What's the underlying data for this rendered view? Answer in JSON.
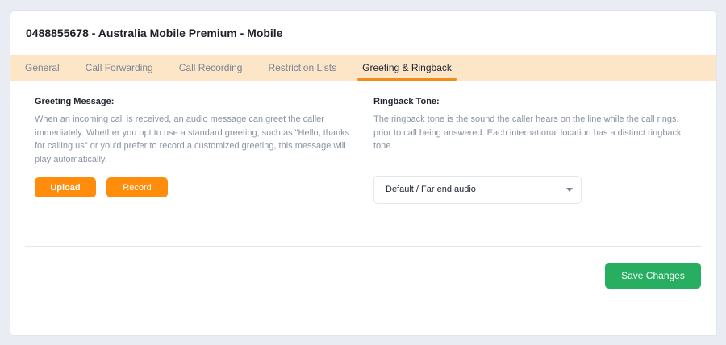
{
  "header": {
    "title": "0488855678  - Australia Mobile Premium - Mobile"
  },
  "tabs": [
    {
      "label": "General",
      "active": false
    },
    {
      "label": "Call Forwarding",
      "active": false
    },
    {
      "label": "Call Recording",
      "active": false
    },
    {
      "label": "Restriction Lists",
      "active": false
    },
    {
      "label": "Greeting & Ringback",
      "active": true
    }
  ],
  "greeting": {
    "title": "Greeting Message:",
    "description": "When an incoming call is received, an audio message can greet the caller immediately. Whether you opt to use a standard greeting, such as \"Hello, thanks for calling us\" or you'd prefer to record a customized greeting, this message will play automatically.",
    "upload_label": "Upload",
    "record_label": "Record"
  },
  "ringback": {
    "title": "Ringback Tone:",
    "description": "The ringback tone is the sound the caller hears on the line while the call rings, prior to call being answered. Each international location has a distinct ringback tone.",
    "selected_value": "Default / Far end audio",
    "dropdown_icon": "chevron-down-icon"
  },
  "footer": {
    "save_label": "Save Changes"
  },
  "colors": {
    "accent_orange": "#ff8c0a",
    "tab_bar_bg": "#fde6c8",
    "save_green": "#27ae60"
  }
}
